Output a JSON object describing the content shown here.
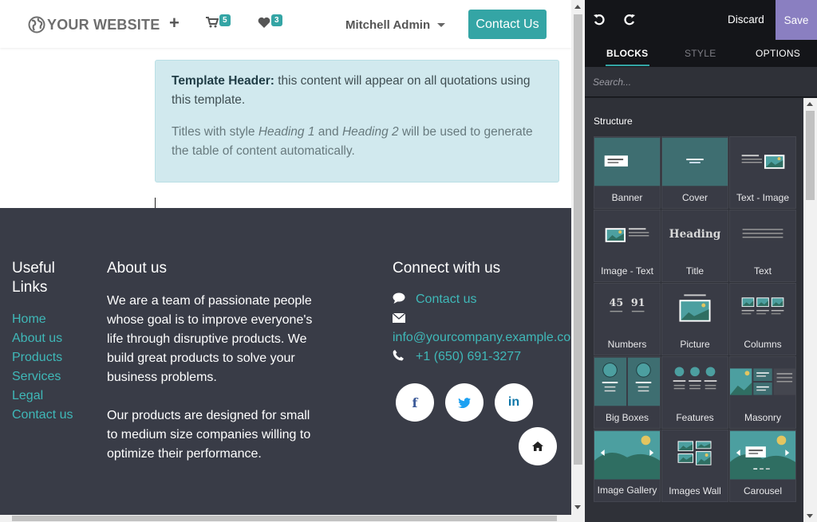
{
  "navbar": {
    "logo_text": "YOUR WEBSITE",
    "plus_label": "+",
    "cart_count": "5",
    "wishlist_count": "3",
    "user_name": "Mitchell Admin",
    "contact_button": "Contact Us"
  },
  "alert": {
    "p1_bold": "Template Header:",
    "p1_rest": " this content will appear on all quotations using this template.",
    "p2_a": "Titles with style ",
    "p2_h1": "Heading 1",
    "p2_and": " and ",
    "p2_h2": "Heading 2",
    "p2_b": " will be used to generate the table of content automatically."
  },
  "footer": {
    "links_title": "Useful Links",
    "links": [
      "Home",
      "About us",
      "Products",
      "Services",
      "Legal",
      "Contact us"
    ],
    "about_title": "About us",
    "about_p1": "We are a team of passionate people whose goal is to improve everyone's life through disruptive products. We build great products to solve your business problems.",
    "about_p2": "Our products are designed for small to medium size companies willing to optimize their performance.",
    "connect_title": "Connect with us",
    "contact_link": "Contact us",
    "email": "info@yourcompany.example.com",
    "phone": "+1 (650) 691-3277",
    "social_facebook": "f",
    "social_linkedin": "in"
  },
  "editor": {
    "discard_label": "Discard",
    "save_label": "Save",
    "tabs": [
      "BLOCKS",
      "STYLE",
      "OPTIONS"
    ],
    "search_placeholder": "Search...",
    "section_title": "Structure",
    "blocks": [
      "Banner",
      "Cover",
      "Text - Image",
      "Image - Text",
      "Title",
      "Text",
      "Numbers",
      "Picture",
      "Columns",
      "Big Boxes",
      "Features",
      "Masonry",
      "Image Gallery",
      "Images Wall",
      "Carousel"
    ],
    "thumb_heading": "Heading",
    "thumb_num1": "45",
    "thumb_num2": "91"
  },
  "colors": {
    "accent": "#34a5a5",
    "footer_bg": "#393c47",
    "save_bg": "#8a7fc1",
    "alert_bg": "#d1e9ee",
    "panel_bg": "#2f3138"
  }
}
